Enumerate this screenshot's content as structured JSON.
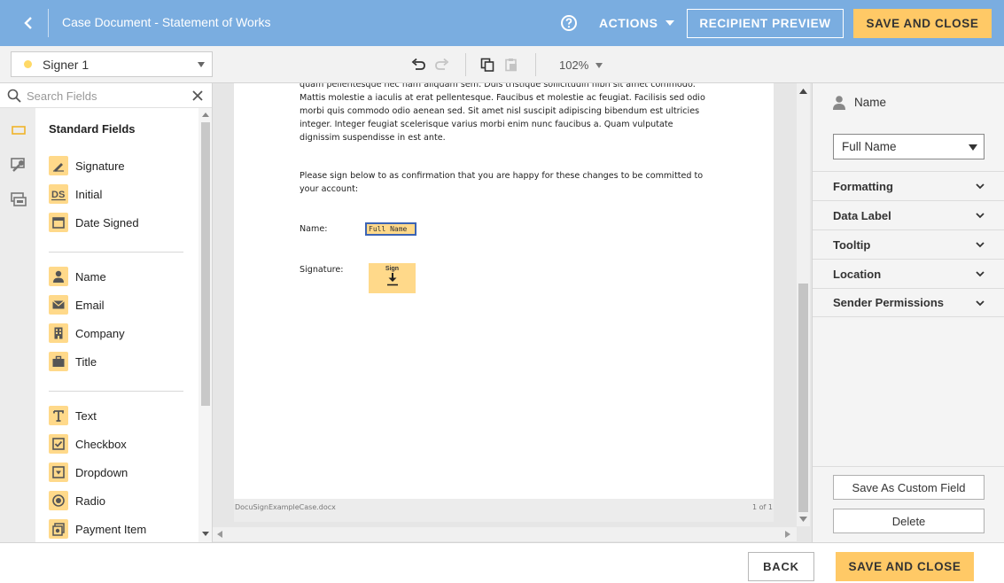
{
  "header": {
    "title": "Case Document - Statement of Works",
    "actions_label": "ACTIONS",
    "recipient_preview_label": "RECIPIENT PREVIEW",
    "save_close_label": "SAVE AND CLOSE",
    "bar_color": "#7aade0",
    "accent_color": "#ffc966"
  },
  "toolbar": {
    "signer": "Signer 1",
    "signer_color": "#ffd966",
    "zoom": "102%"
  },
  "left_panel": {
    "search_placeholder": "Search Fields",
    "section_title": "Standard Fields",
    "groups": [
      [
        {
          "label": "Signature",
          "icon": "pen-icon"
        },
        {
          "label": "Initial",
          "icon": "initial-ds-icon"
        },
        {
          "label": "Date Signed",
          "icon": "calendar-icon"
        }
      ],
      [
        {
          "label": "Name",
          "icon": "person-icon"
        },
        {
          "label": "Email",
          "icon": "envelope-icon"
        },
        {
          "label": "Company",
          "icon": "building-icon"
        },
        {
          "label": "Title",
          "icon": "briefcase-icon"
        }
      ],
      [
        {
          "label": "Text",
          "icon": "text-t-icon"
        },
        {
          "label": "Checkbox",
          "icon": "checkbox-icon"
        },
        {
          "label": "Dropdown",
          "icon": "dropdown-icon"
        },
        {
          "label": "Radio",
          "icon": "radio-icon"
        },
        {
          "label": "Payment Item",
          "icon": "payment-icon"
        }
      ]
    ]
  },
  "document": {
    "paragraph1": "quam pellentesque nec nam aliquam sem. Duis tristique sollicitudin nibh sit amet commodo. Mattis molestie a iaculis at erat pellentesque. Faucibus et molestie ac feugiat. Facilisis sed odio morbi quis commodo odio aenean sed. Sit amet nisl suscipit adipiscing bibendum est ultricies integer. Integer feugiat scelerisque varius morbi enim nunc faucibus a. Quam vulputate dignissim suspendisse in est ante.",
    "paragraph2": "Please sign below to as confirmation that you are happy for these changes to be committed to your account:",
    "name_label": "Name:",
    "name_field_text": "Full Name",
    "signature_label": "Signature:",
    "sign_field_text": "Sign",
    "file_name": "DocuSignExampleCase.docx",
    "page_indicator": "1 of 1"
  },
  "right_panel": {
    "field_type": "Name",
    "select_value": "Full Name",
    "sections": [
      "Formatting",
      "Data Label",
      "Tooltip",
      "Location",
      "Sender Permissions"
    ],
    "save_custom_label": "Save As Custom Field",
    "delete_label": "Delete"
  },
  "footer": {
    "back_label": "BACK",
    "save_close_label": "SAVE AND CLOSE"
  }
}
